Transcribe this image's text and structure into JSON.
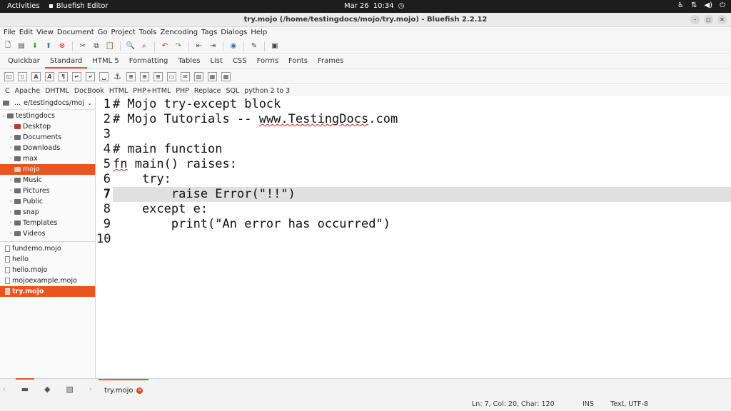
{
  "topbar": {
    "activities": "Activities",
    "app_name": "Bluefish Editor",
    "date": "Mar 26",
    "time": "10:34",
    "tray_icons": [
      "accessibility-icon",
      "network-icon",
      "volume-icon",
      "power-icon"
    ]
  },
  "window": {
    "title": "try.mojo (/home/testingdocs/mojo/try.mojo) - Bluefish 2.2.12"
  },
  "menu": [
    "File",
    "Edit",
    "View",
    "Document",
    "Go",
    "Project",
    "Tools",
    "Zencoding",
    "Tags",
    "Dialogs",
    "Help"
  ],
  "tabs": [
    "Quickbar",
    "Standard",
    "HTML 5",
    "Formatting",
    "Tables",
    "List",
    "CSS",
    "Forms",
    "Fonts",
    "Frames"
  ],
  "active_tab": "Standard",
  "snippets": [
    "C",
    "Apache",
    "DHTML",
    "DocBook",
    "HTML",
    "PHP+HTML",
    "PHP",
    "Replace",
    "SQL",
    "python 2 to 3"
  ],
  "sidebar": {
    "path_prefix": "...",
    "path": "e/testingdocs/mojo",
    "root": "testingdocs",
    "folders": [
      "Desktop",
      "Documents",
      "Downloads",
      "max",
      "mojo",
      "Music",
      "Pictures",
      "Public",
      "snap",
      "Templates",
      "Videos"
    ],
    "selected_folder": "mojo",
    "files": [
      "fundemo.mojo",
      "hello",
      "hello.mojo",
      "mojoexample.mojo",
      "try.mojo"
    ],
    "selected_file": "try.mojo"
  },
  "editor": {
    "lines": [
      {
        "n": "1",
        "text": "# Mojo try-except block"
      },
      {
        "n": "2",
        "text": "# Mojo Tutorials -- www.TestingDocs.com"
      },
      {
        "n": "3",
        "text": ""
      },
      {
        "n": "4",
        "text": "# main function"
      },
      {
        "n": "5",
        "text": "fn main() raises:"
      },
      {
        "n": "6",
        "text": "    try:"
      },
      {
        "n": "7",
        "text": "        raise Error(\"!!\")"
      },
      {
        "n": "8",
        "text": "    except e:"
      },
      {
        "n": "9",
        "text": "        print(\"An error has occurred\")"
      },
      {
        "n": "10",
        "text": ""
      }
    ],
    "current_line": 7
  },
  "doc_tab": "try.mojo",
  "status": {
    "position": "Ln: 7, Col: 20, Char: 120",
    "mode": "INS",
    "encoding": "Text, UTF-8"
  }
}
